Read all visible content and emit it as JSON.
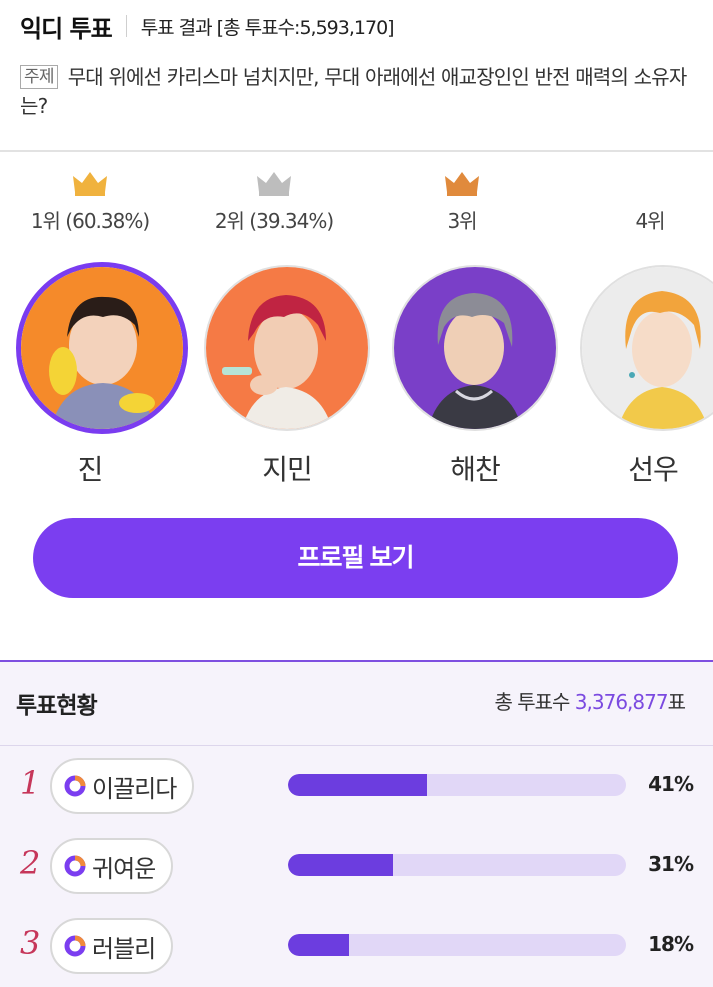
{
  "header": {
    "app_title": "익디 투표",
    "result_title": "투표 결과 [총 투표수:5,593,170]"
  },
  "topic": {
    "badge": "주제",
    "text": "무대 위에선 카리스마 넘치지만, 무대 아래에선 애교장인인 반전 매력의 소유자는?"
  },
  "ranking": [
    {
      "rank_label": "1위 (60.38%)",
      "name": "진",
      "crown_color": "#f0b23e",
      "crown": "gold-crown-icon",
      "ring_color": "#7a3cf0",
      "bg_color": "#f58a2a"
    },
    {
      "rank_label": "2위 (39.34%)",
      "name": "지민",
      "crown_color": "#bdbdbd",
      "crown": "silver-crown-icon",
      "ring_color": "#e0e0e0",
      "bg_color": "#f57a45"
    },
    {
      "rank_label": "3위",
      "name": "해찬",
      "crown_color": "#e08a3c",
      "crown": "bronze-crown-icon",
      "ring_color": "#e0e0e0",
      "bg_color": "#7a3fc8"
    },
    {
      "rank_label": "4위",
      "name": "선우",
      "ring_color": "#e0e0e0",
      "bg_color": "#ececec"
    }
  ],
  "profile_button": "프로필 보기",
  "status": {
    "title": "투표현황",
    "total_prefix": "총 투표수 ",
    "total_value": "3,376,877",
    "total_suffix": "표",
    "items": [
      {
        "rank": "1",
        "label": "이끌리다",
        "percent": "41%",
        "value": 41
      },
      {
        "rank": "2",
        "label": "귀여운",
        "percent": "31%",
        "value": 31
      },
      {
        "rank": "3",
        "label": "러블리",
        "percent": "18%",
        "value": 18
      }
    ]
  },
  "colors": {
    "accent": "#7b3ef0",
    "bar_fill": "#6c3ddf",
    "bar_track": "#e1d7f7",
    "rank_number": "#c6365a"
  }
}
